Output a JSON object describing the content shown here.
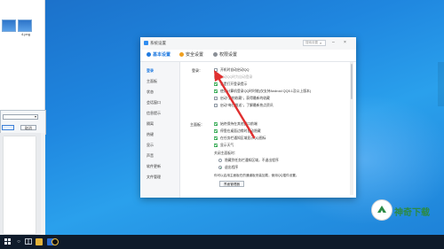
{
  "desktop": {
    "file1_label": "",
    "file2_label": "4.png"
  },
  "left_dialog": {
    "dropdown_value": "",
    "ok_label": "",
    "cancel_label": "取消"
  },
  "window": {
    "title": "系统设置",
    "search_placeholder": "搜索设置",
    "tabs": [
      {
        "label": "基本设置",
        "color": "#1f7ae0"
      },
      {
        "label": "安全设置",
        "color": "#f0a020"
      },
      {
        "label": "权限设置",
        "color": "#8a8f96"
      }
    ],
    "sidebar": [
      "登录",
      "主面板",
      "状态",
      "会话窗口",
      "信息提示",
      "隔离",
      "热键",
      "显示",
      "声音",
      "软件更新",
      "文件管理"
    ],
    "login": {
      "section_label": "登录：",
      "options": [
        {
          "label": "开机时自动启动QQ",
          "checked": false
        },
        {
          "label": "启动QQ时为自动登录",
          "checked": false,
          "muted": true
        },
        {
          "label": "总是打开登录提示",
          "checked": true
        },
        {
          "label": "使用计算机登录QQ时时能(仅支持Android QQ5.1及以上版本)",
          "checked": true
        },
        {
          "label": "启动\"我的收藏\"，获得最新的收藏",
          "checked": false
        },
        {
          "label": "启动\"每日推送\"，了解最新热点资讯",
          "checked": false
        }
      ]
    },
    "main_panel": {
      "section_label": "主面板：",
      "options": [
        {
          "label": "始终保持在其他窗口前端",
          "checked": true
        },
        {
          "label": "停靠在桌面边缘时自动隐藏",
          "checked": true
        },
        {
          "label": "在任务栏通知区域显示QQ图标",
          "checked": true
        },
        {
          "label": "显示天气",
          "checked": true
        }
      ],
      "close_label": "关闭主面板时：",
      "radios": [
        {
          "label": "隐藏到任务栏通知区域，不退出程序",
          "checked": false
        },
        {
          "label": "退出程序",
          "checked": true
        }
      ],
      "note": "你可以启用主面板在的通道板安装加载，使用QQ插件设置。",
      "manage_button": "界面管理器"
    }
  },
  "accent": {
    "green": "#2fa84f",
    "blue": "#1f7ae0",
    "arrow": "#e03030"
  },
  "watermark": {
    "text": "神奇下载"
  }
}
